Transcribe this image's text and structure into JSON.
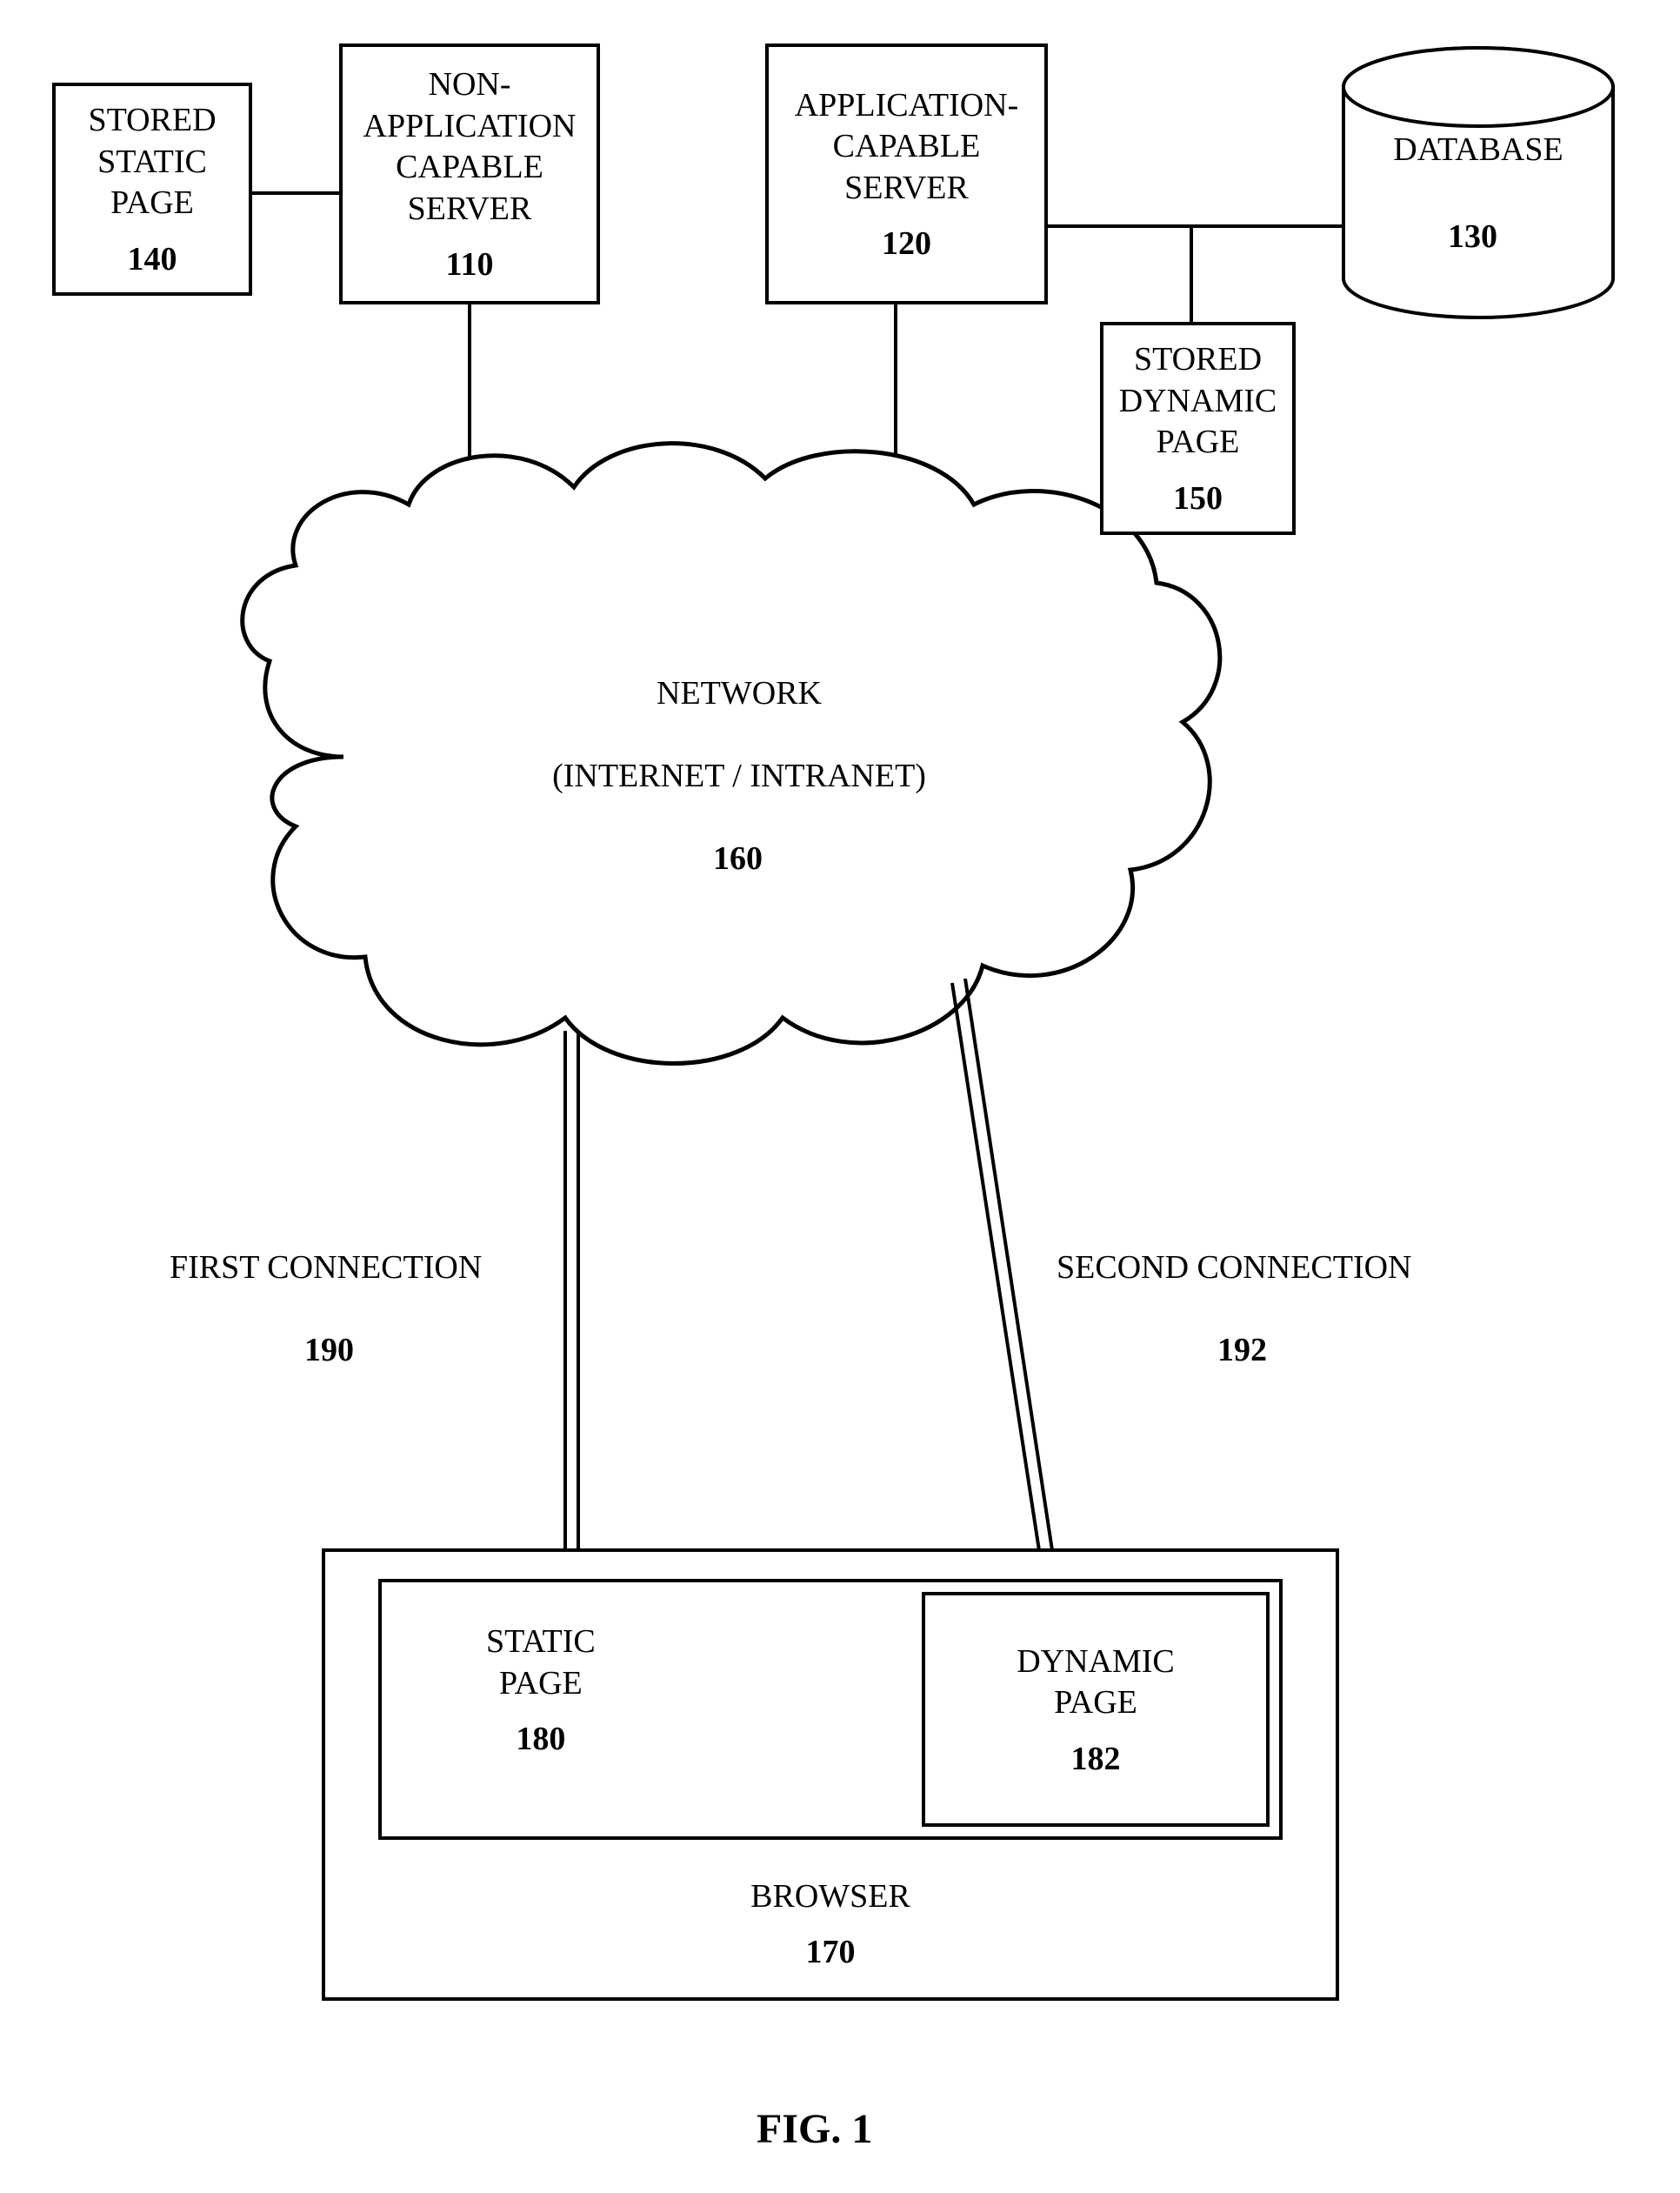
{
  "boxes": {
    "stored_static_page": {
      "label": "STORED\nSTATIC\nPAGE",
      "num": "140"
    },
    "non_app_server": {
      "label": "NON-\nAPPLICATION\nCAPABLE\nSERVER",
      "num": "110"
    },
    "app_server": {
      "label": "APPLICATION-\nCAPABLE\nSERVER",
      "num": "120"
    },
    "database": {
      "label": "DATABASE",
      "num": "130"
    },
    "stored_dynamic_page": {
      "label": "STORED\nDYNAMIC\nPAGE",
      "num": "150"
    },
    "static_page": {
      "label": "STATIC\nPAGE",
      "num": "180"
    },
    "dynamic_page": {
      "label": "DYNAMIC\nPAGE",
      "num": "182"
    },
    "browser": {
      "label": "BROWSER",
      "num": "170"
    }
  },
  "cloud": {
    "line1": "NETWORK",
    "line2": "(INTERNET / INTRANET)",
    "num": "160"
  },
  "connections": {
    "first": {
      "label": "FIRST CONNECTION",
      "num": "190"
    },
    "second": {
      "label": "SECOND CONNECTION",
      "num": "192"
    }
  },
  "figure_caption": "FIG. 1"
}
